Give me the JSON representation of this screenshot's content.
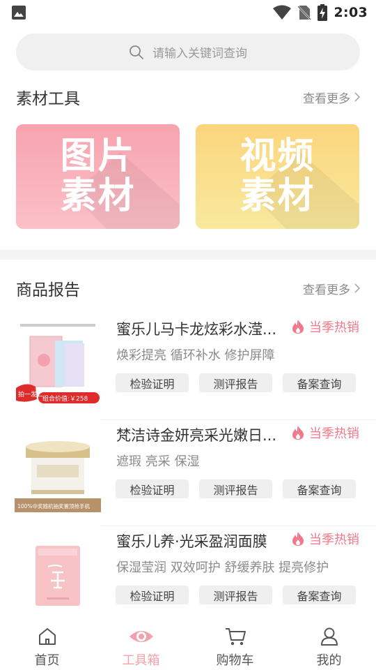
{
  "status_bar": {
    "time": "2:03"
  },
  "search": {
    "placeholder": "请输入关键词查询"
  },
  "materials": {
    "title": "素材工具",
    "more": "查看更多",
    "tiles": [
      {
        "line1": "图片",
        "line2": "素材",
        "color": "#f7a3ae"
      },
      {
        "line1": "视频",
        "line2": "素材",
        "color": "#fbd57d"
      }
    ]
  },
  "reports": {
    "title": "商品报告",
    "more": "查看更多",
    "products": [
      {
        "name": "蜜乐儿马卡龙炫彩水滢...",
        "hot": "当季热销",
        "tags": "焕彩提亮 循环补水 修护屏障",
        "thumb_badge": "拍一发二",
        "thumb_price": "组合价值:￥258",
        "buttons": [
          "检验证明",
          "测评报告",
          "备案查询"
        ]
      },
      {
        "name": "梵洁诗金妍亮采光嫩日...",
        "hot": "当季热销",
        "tags": "遮瑕 亮采 保湿",
        "thumb_caption": "100%中奖随机抽奖置顶抢手机",
        "buttons": [
          "检验证明",
          "测评报告",
          "备案查询"
        ]
      },
      {
        "name": "蜜乐儿养·光采盈润面膜",
        "hot": "当季热销",
        "tags": "保湿莹润 双效呵护 舒缓养肤 提亮修护",
        "buttons": [
          "检验证明",
          "测评报告",
          "备案查询"
        ]
      }
    ]
  },
  "tabbar": {
    "items": [
      {
        "label": "首页",
        "icon": "home-icon"
      },
      {
        "label": "工具箱",
        "icon": "eye-icon",
        "active": true
      },
      {
        "label": "购物车",
        "icon": "cart-icon"
      },
      {
        "label": "我的",
        "icon": "user-icon"
      }
    ],
    "active_color": "#f2a0aa"
  }
}
